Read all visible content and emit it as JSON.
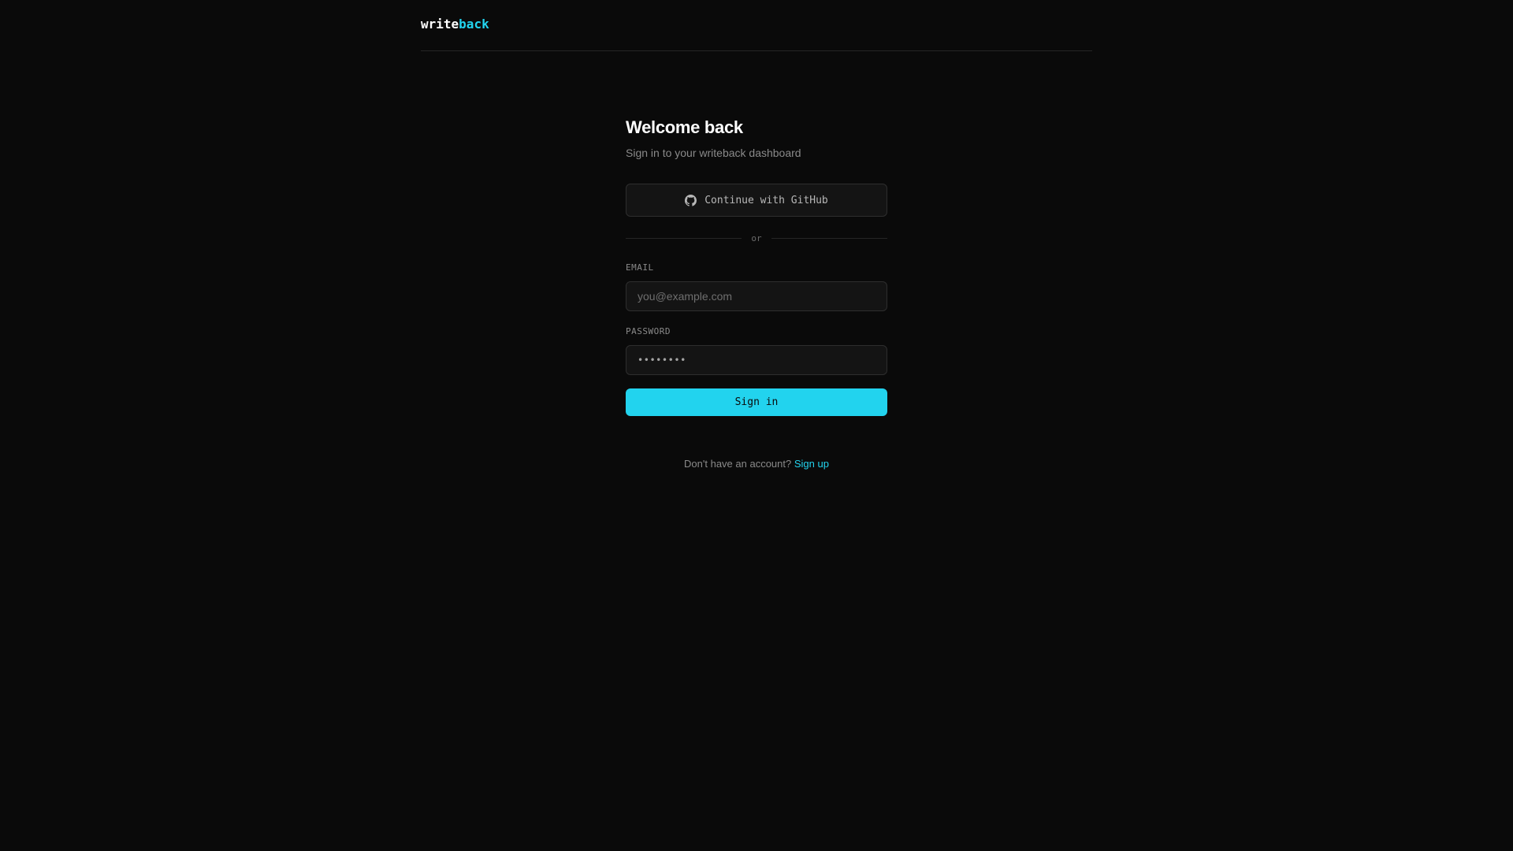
{
  "brand": {
    "logo_primary": "write",
    "logo_accent": "back",
    "accent_color": "#22d3ee"
  },
  "auth": {
    "title": "Welcome back",
    "subtitle": "Sign in to your writeback dashboard",
    "github_button_label": "Continue with GitHub",
    "github_icon": "github-icon",
    "divider_label": "or",
    "email": {
      "label": "EMAIL",
      "placeholder": "you@example.com",
      "value": ""
    },
    "password": {
      "label": "PASSWORD",
      "value": "••••••••"
    },
    "submit_label": "Sign in",
    "footer_text": "Don't have an account?",
    "signup_link": "Sign up"
  }
}
